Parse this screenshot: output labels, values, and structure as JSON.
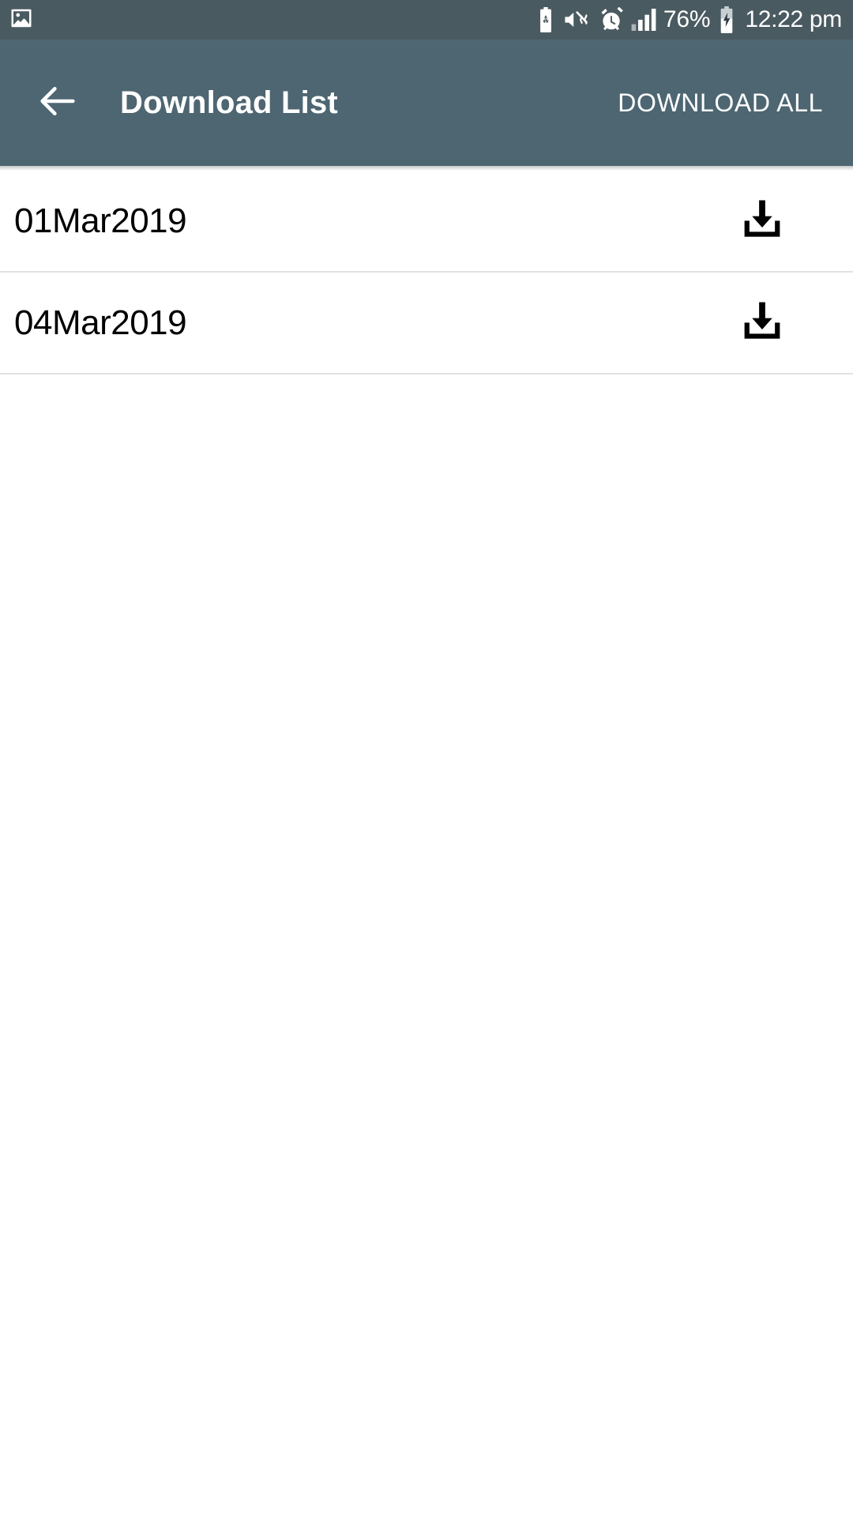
{
  "status_bar": {
    "background_color": "#4a5a61",
    "notification_icons": [
      {
        "name": "gallery-icon",
        "label": "Gallery"
      }
    ],
    "system_icons": [
      {
        "name": "power-saving-icon",
        "label": "Power saving"
      },
      {
        "name": "sound-off-vibrate-icon",
        "label": "Vibrate / mute"
      },
      {
        "name": "alarm-icon",
        "label": "Alarm set"
      },
      {
        "name": "signal-bars-icon",
        "label": "Signal strength"
      }
    ],
    "battery_percent": "76%",
    "battery_icon": {
      "name": "battery-charging-icon",
      "label": "Charging"
    },
    "clock": "12:22 pm"
  },
  "appbar": {
    "background_color": "#4d6672",
    "back_icon": "arrow-left-icon",
    "title": "Download List",
    "action_label": "DOWNLOAD ALL"
  },
  "list": {
    "divider_color": "#e2e2e2",
    "row_action_icon": "download-icon",
    "rows": [
      {
        "label": "01Mar2019"
      },
      {
        "label": "04Mar2019"
      }
    ]
  }
}
